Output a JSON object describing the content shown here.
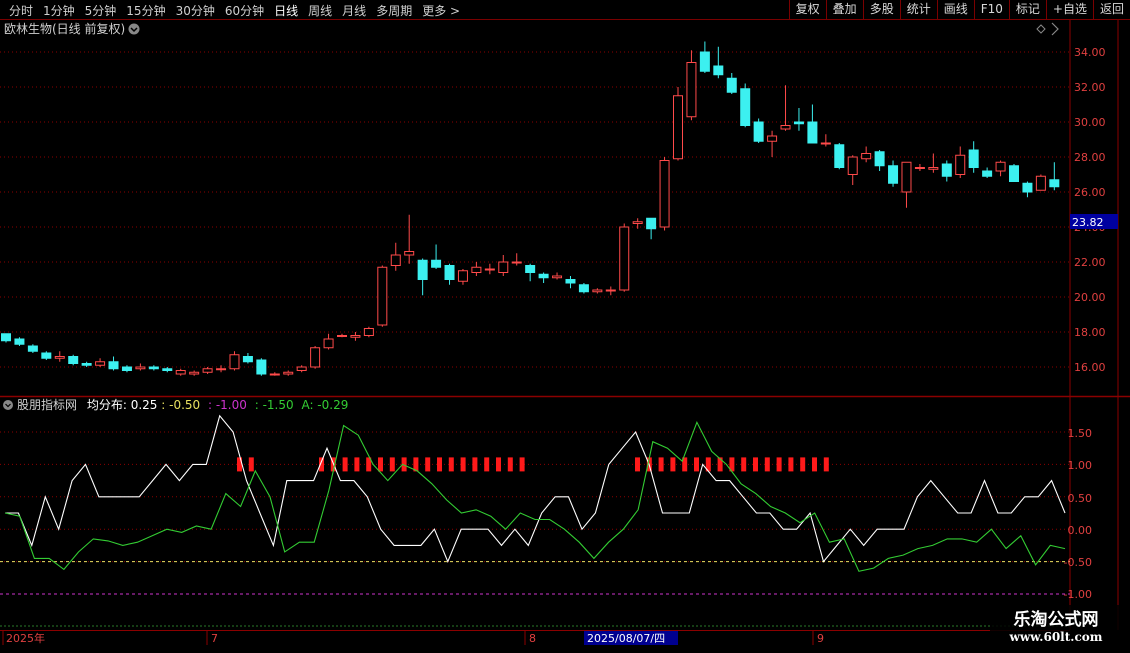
{
  "toolbar": {
    "periods": [
      "分时",
      "1分钟",
      "5分钟",
      "15分钟",
      "30分钟",
      "60分钟",
      "日线",
      "周线",
      "月线",
      "多周期",
      "更多 >"
    ],
    "active_period": "日线",
    "actions": [
      "复权",
      "叠加",
      "多股",
      "统计",
      "画线",
      "F10",
      "标记",
      "+自选",
      "返回"
    ]
  },
  "main_chart": {
    "title": "欧林生物(日线 前复权)",
    "price_tag": "23.82",
    "y_ticks": [
      "34.00",
      "32.00",
      "30.00",
      "28.00",
      "26.00",
      "24.00",
      "22.00",
      "20.00",
      "18.00",
      "16.00"
    ]
  },
  "indicator": {
    "name": "股朋指标网",
    "label_prefix": "均分布: 0.25",
    "val_yellow": ": -0.50",
    "val_purple": ": -1.00",
    "val_green": ": -1.50",
    "val_a": "A: -0.29",
    "y_ticks": [
      "1.50",
      "1.00",
      "0.50",
      "0.00",
      "-0.50",
      "-1.00"
    ]
  },
  "x_axis": {
    "labels": [
      "2025年",
      "7",
      "8",
      "9"
    ],
    "cursor_date": "2025/08/07/四"
  },
  "watermark": {
    "title": "乐淘公式网",
    "url": "www.60lt.com"
  },
  "colors": {
    "up": "#ff4a4a",
    "down": "#3cf0f0",
    "white_line": "#ffffff",
    "green_line": "#33cc33",
    "grid": "#8b0000"
  },
  "chart_data": {
    "type": "candlestick",
    "price_ylim": [
      15,
      35
    ],
    "candles": [
      [
        17.9,
        17.5,
        17.9,
        17.4
      ],
      [
        17.6,
        17.3,
        17.7,
        17.2
      ],
      [
        17.2,
        16.9,
        17.3,
        16.8
      ],
      [
        16.8,
        16.5,
        16.9,
        16.4
      ],
      [
        16.5,
        16.6,
        16.9,
        16.3
      ],
      [
        16.6,
        16.2,
        16.7,
        16.1
      ],
      [
        16.2,
        16.1,
        16.3,
        16.0
      ],
      [
        16.1,
        16.3,
        16.5,
        16.0
      ],
      [
        16.3,
        15.9,
        16.6,
        15.8
      ],
      [
        16.0,
        15.8,
        16.1,
        15.7
      ],
      [
        15.9,
        16.0,
        16.2,
        15.8
      ],
      [
        16.0,
        15.9,
        16.1,
        15.8
      ],
      [
        15.9,
        15.8,
        16.0,
        15.7
      ],
      [
        15.6,
        15.8,
        15.9,
        15.5
      ],
      [
        15.6,
        15.7,
        15.8,
        15.5
      ],
      [
        15.7,
        15.9,
        16.0,
        15.6
      ],
      [
        15.9,
        15.9,
        16.1,
        15.7
      ],
      [
        15.9,
        16.7,
        16.9,
        15.8
      ],
      [
        16.6,
        16.3,
        16.8,
        16.2
      ],
      [
        16.4,
        15.6,
        16.5,
        15.5
      ],
      [
        15.6,
        15.6,
        15.7,
        15.5
      ],
      [
        15.6,
        15.7,
        15.8,
        15.5
      ],
      [
        15.8,
        16.0,
        16.1,
        15.7
      ],
      [
        16.0,
        17.1,
        17.2,
        15.9
      ],
      [
        17.1,
        17.6,
        17.9,
        17.0
      ],
      [
        17.8,
        17.8,
        17.9,
        17.7
      ],
      [
        17.7,
        17.8,
        18.0,
        17.5
      ],
      [
        17.8,
        18.2,
        18.3,
        17.7
      ],
      [
        18.4,
        21.7,
        21.8,
        18.3
      ],
      [
        21.8,
        22.4,
        23.1,
        21.5
      ],
      [
        22.4,
        22.6,
        24.7,
        21.9
      ],
      [
        22.1,
        21.0,
        22.2,
        20.1
      ],
      [
        22.1,
        21.7,
        23.0,
        21.6
      ],
      [
        21.8,
        21.0,
        21.9,
        20.7
      ],
      [
        20.9,
        21.5,
        21.6,
        20.7
      ],
      [
        21.4,
        21.7,
        22.0,
        21.2
      ],
      [
        21.6,
        21.6,
        21.9,
        21.3
      ],
      [
        21.4,
        22.0,
        22.4,
        21.2
      ],
      [
        22.0,
        22.0,
        22.5,
        21.8
      ],
      [
        21.8,
        21.4,
        21.9,
        20.9
      ],
      [
        21.3,
        21.1,
        21.4,
        20.8
      ],
      [
        21.1,
        21.2,
        21.4,
        21.0
      ],
      [
        21.0,
        20.8,
        21.2,
        20.5
      ],
      [
        20.7,
        20.3,
        20.8,
        20.2
      ],
      [
        20.3,
        20.4,
        20.5,
        20.2
      ],
      [
        20.4,
        20.4,
        20.6,
        20.1
      ],
      [
        20.4,
        24.0,
        24.2,
        20.3
      ],
      [
        24.2,
        24.3,
        24.5,
        23.9
      ],
      [
        24.5,
        23.9,
        24.5,
        23.3
      ],
      [
        24.0,
        27.8,
        28.0,
        23.8
      ],
      [
        27.9,
        31.5,
        32.0,
        27.8
      ],
      [
        30.3,
        33.4,
        34.1,
        30.1
      ],
      [
        34.0,
        32.9,
        34.6,
        32.8
      ],
      [
        33.2,
        32.7,
        34.3,
        32.5
      ],
      [
        32.5,
        31.7,
        32.8,
        31.6
      ],
      [
        31.9,
        29.8,
        32.2,
        29.7
      ],
      [
        30.0,
        28.9,
        30.2,
        28.8
      ],
      [
        28.9,
        29.2,
        29.5,
        28.0
      ],
      [
        29.6,
        29.8,
        32.1,
        29.5
      ],
      [
        30.0,
        29.9,
        30.8,
        29.5
      ],
      [
        30.0,
        28.8,
        31.0,
        28.8
      ],
      [
        28.8,
        28.8,
        29.3,
        28.6
      ],
      [
        28.7,
        27.4,
        28.8,
        27.3
      ],
      [
        27.0,
        28.0,
        28.1,
        26.4
      ],
      [
        27.9,
        28.2,
        28.6,
        27.7
      ],
      [
        28.3,
        27.5,
        28.4,
        27.2
      ],
      [
        27.5,
        26.5,
        27.8,
        26.3
      ],
      [
        26.0,
        27.7,
        27.7,
        25.1
      ],
      [
        27.4,
        27.4,
        27.6,
        27.2
      ],
      [
        27.3,
        27.4,
        28.2,
        27.1
      ],
      [
        27.6,
        26.9,
        27.8,
        26.6
      ],
      [
        27.0,
        28.1,
        28.6,
        26.8
      ],
      [
        28.4,
        27.4,
        28.9,
        27.1
      ],
      [
        27.2,
        26.9,
        27.4,
        26.8
      ],
      [
        27.2,
        27.7,
        27.8,
        26.9
      ],
      [
        27.5,
        26.6,
        27.6,
        26.6
      ],
      [
        26.5,
        26.0,
        26.6,
        25.7
      ],
      [
        26.1,
        26.9,
        27.0,
        26.1
      ],
      [
        26.7,
        26.3,
        27.7,
        26.1
      ]
    ],
    "indicator_ylim": [
      -1.15,
      1.9
    ],
    "white_line": [
      0.25,
      0.25,
      -0.25,
      0.5,
      0,
      0.75,
      1,
      0.5,
      0.5,
      0.5,
      0.5,
      0.75,
      1,
      0.75,
      1,
      1,
      1.75,
      1.5,
      0.75,
      0.25,
      -0.25,
      0.75,
      0.75,
      0.75,
      1.25,
      0.75,
      0.75,
      0.5,
      0,
      -0.25,
      -0.25,
      -0.25,
      0,
      -0.5,
      0,
      0,
      0,
      -0.25,
      0,
      -0.25,
      0.25,
      0.5,
      0.5,
      0,
      0.25,
      1,
      1.25,
      1.5,
      1,
      0.25,
      0.25,
      0.25,
      1,
      0.75,
      0.75,
      0.5,
      0.25,
      0.25,
      0,
      0,
      0.25,
      -0.5,
      -0.25,
      0,
      -0.25,
      0,
      0,
      0,
      0.5,
      0.75,
      0.5,
      0.25,
      0.25,
      0.75,
      0.25,
      0.25,
      0.5,
      0.5,
      0.75,
      0.25
    ],
    "green_line": [
      0.25,
      0.2,
      -0.45,
      -0.45,
      -0.62,
      -0.35,
      -0.15,
      -0.18,
      -0.25,
      -0.2,
      -0.1,
      0.0,
      -0.05,
      0.05,
      0.0,
      0.55,
      0.35,
      0.9,
      0.5,
      -0.35,
      -0.2,
      -0.2,
      0.6,
      1.6,
      1.45,
      1.0,
      0.75,
      1.0,
      0.9,
      0.7,
      0.45,
      0.25,
      0.3,
      0.2,
      0.0,
      0.25,
      0.15,
      0.15,
      0.0,
      -0.2,
      -0.45,
      -0.2,
      0.0,
      0.3,
      1.35,
      1.25,
      1.05,
      1.65,
      1.2,
      1.0,
      0.7,
      0.55,
      0.35,
      0.25,
      0.1,
      0.25,
      -0.2,
      -0.15,
      -0.65,
      -0.6,
      -0.45,
      -0.4,
      -0.3,
      -0.25,
      -0.15,
      -0.15,
      -0.2,
      0.0,
      -0.3,
      -0.1,
      -0.55,
      -0.25,
      -0.3
    ],
    "red_bars": [
      [
        17,
        18
      ],
      [
        23,
        33
      ],
      [
        47,
        61
      ]
    ],
    "ref_lines": [
      {
        "value": 1.0,
        "color": "#d8d860"
      },
      {
        "value": -0.5,
        "color": "#e8e060"
      },
      {
        "value": -1.0,
        "color": "#cc33cc"
      }
    ]
  }
}
